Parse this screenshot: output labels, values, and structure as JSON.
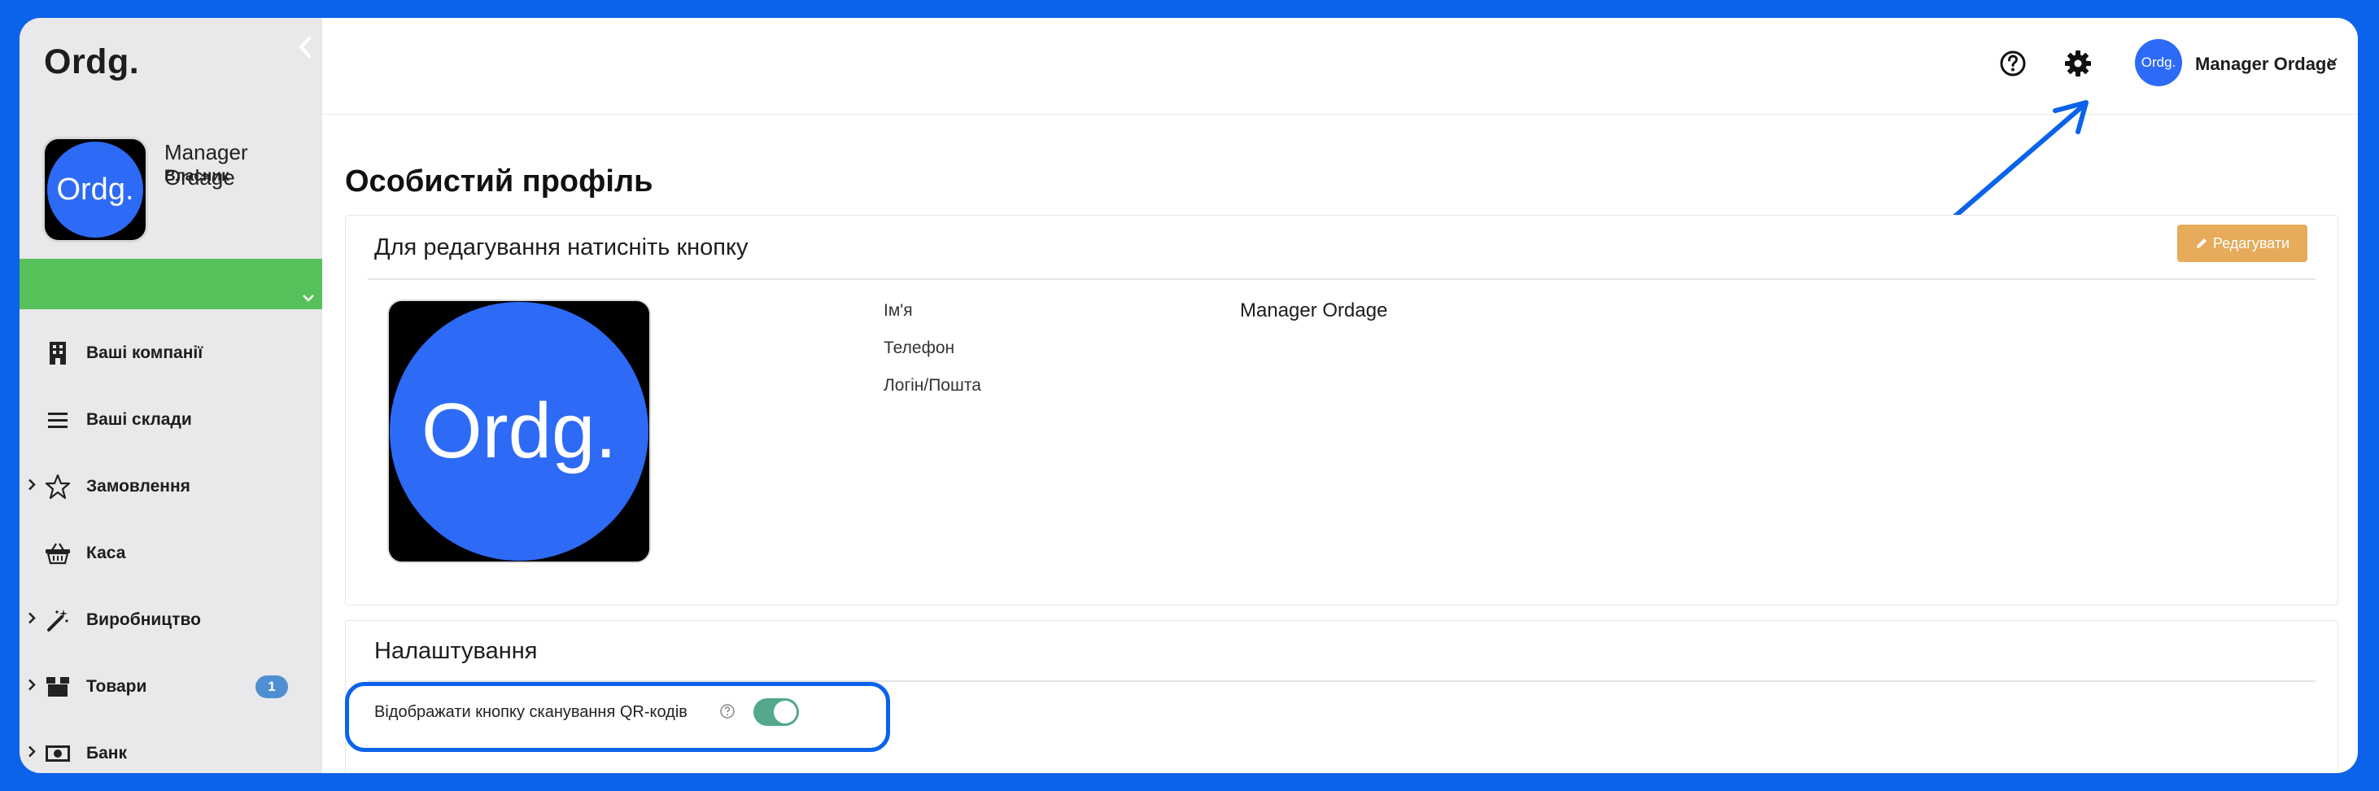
{
  "colors": {
    "frame": "#0a63ea",
    "sidebar_bg": "#e9e8ea",
    "company_bar": "#56c15a",
    "avatar_blue": "#2d6af6",
    "edit_button": "#e6ab5b",
    "badge": "#4d8fd0",
    "toggle_on": "#53a98a"
  },
  "sidebar": {
    "logo": "Ordg.",
    "avatar_text": "Ordg.",
    "profile_name": "Manager Ordage",
    "profile_role": "Власник",
    "items": [
      {
        "label": "Ваші компанії",
        "icon": "building-icon",
        "expandable": false
      },
      {
        "label": "Ваші склади",
        "icon": "list-icon",
        "expandable": false
      },
      {
        "label": "Замовлення",
        "icon": "star-icon",
        "expandable": true
      },
      {
        "label": "Каса",
        "icon": "basket-icon",
        "expandable": false
      },
      {
        "label": "Виробництво",
        "icon": "magic-wand-icon",
        "expandable": true
      },
      {
        "label": "Товари",
        "icon": "box-icon",
        "expandable": true,
        "badge": "1"
      },
      {
        "label": "Банк",
        "icon": "money-icon",
        "expandable": true
      }
    ]
  },
  "header": {
    "help_icon": "help-circle-icon",
    "settings_icon": "gear-icon",
    "avatar_text": "Ordg.",
    "user_name": "Manager Ordage"
  },
  "main": {
    "page_title": "Особистий профіль",
    "profile_card": {
      "title": "Для редагування натисніть кнопку",
      "edit_label": "Редагувати",
      "photo_text": "Ordg.",
      "fields": [
        {
          "label": "Ім'я",
          "value": "Manager Ordage"
        },
        {
          "label": "Телефон",
          "value": ""
        },
        {
          "label": "Логін/Пошта",
          "value": ""
        }
      ]
    },
    "settings_card": {
      "title": "Налаштування",
      "qr_label": "Відображати кнопку сканування QR-кодів",
      "qr_enabled": true
    }
  }
}
